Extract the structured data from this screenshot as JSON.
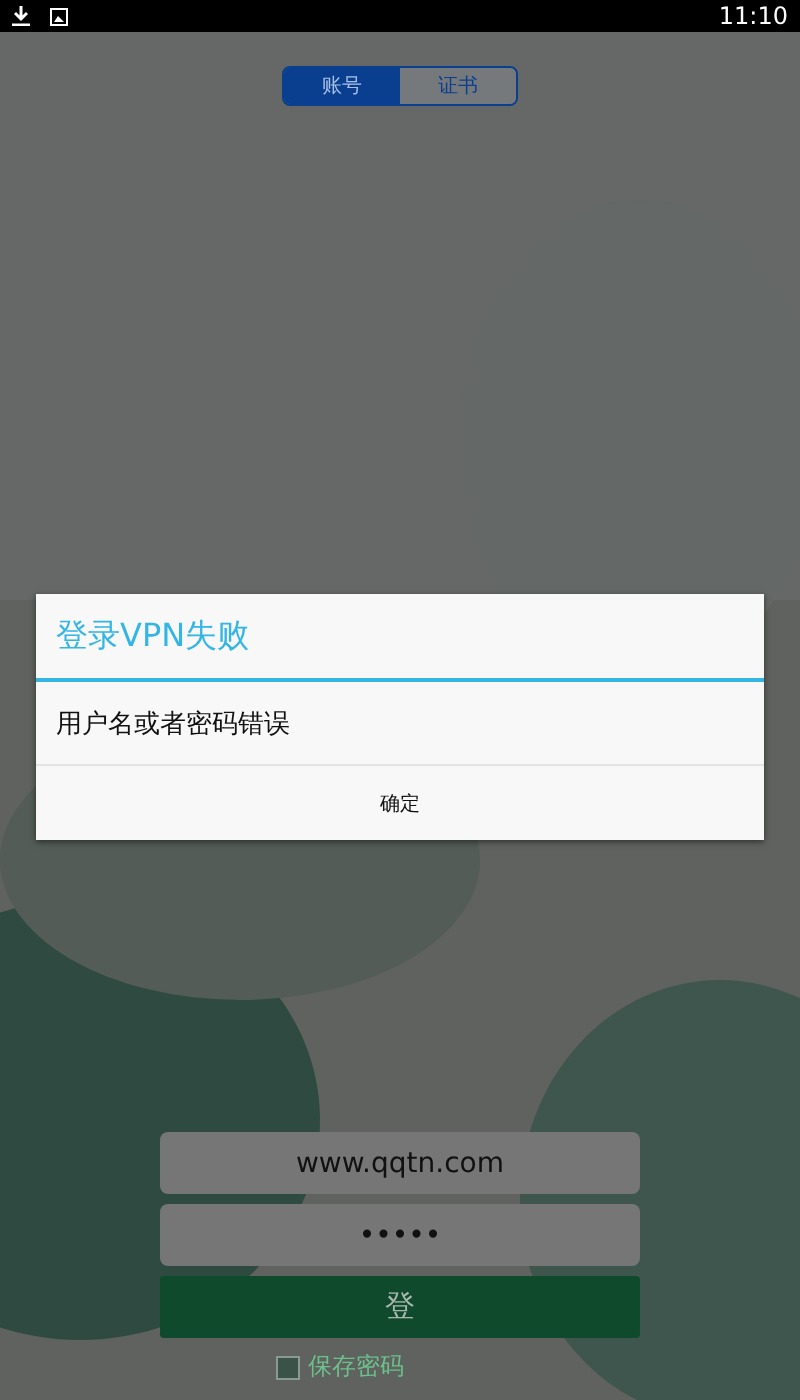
{
  "status_bar": {
    "time": "11:10"
  },
  "tabs": [
    {
      "label": "账号",
      "selected": true
    },
    {
      "label": "证书",
      "selected": false
    }
  ],
  "login_form": {
    "username": "www.qqtn.com",
    "password": "•••••",
    "login_button": "登",
    "save_password": {
      "label": "保存密码",
      "checked": false
    }
  },
  "dialog": {
    "title": "登录VPN失败",
    "message": "用户名或者密码错误",
    "button": "确定"
  }
}
